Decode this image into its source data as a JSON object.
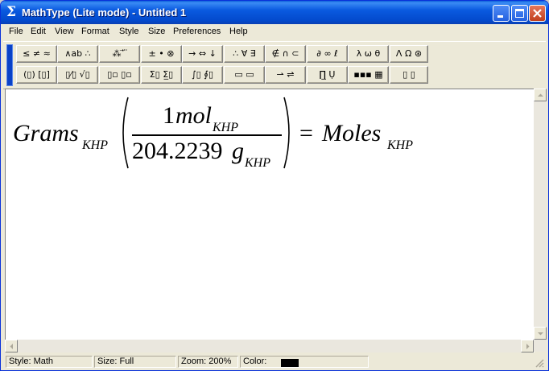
{
  "window": {
    "title": "MathType (Lite mode) - Untitled 1",
    "app_icon_glyph": "Σ",
    "controls": [
      "minimize-icon",
      "maximize-icon",
      "close-icon"
    ]
  },
  "menu": {
    "items": [
      "File",
      "Edit",
      "View",
      "Format",
      "Style",
      "Size",
      "Preferences",
      "Help"
    ]
  },
  "toolbar": {
    "row1": [
      {
        "icon": "relations-palette-icon",
        "glyph": "≤ ≠ ≈"
      },
      {
        "icon": "spaces-ellipses-palette-icon",
        "glyph": "∧ab ∴"
      },
      {
        "icon": "embellishments-palette-icon",
        "glyph": "⁂ ⃗ ⃛"
      },
      {
        "icon": "operators-palette-icon",
        "glyph": "± • ⊗"
      },
      {
        "icon": "arrows-palette-icon",
        "glyph": "→ ⇔ ↓"
      },
      {
        "icon": "logic-palette-icon",
        "glyph": "∴ ∀ ∃"
      },
      {
        "icon": "set-theory-palette-icon",
        "glyph": "∉ ∩ ⊂"
      },
      {
        "icon": "calculus-palette-icon",
        "glyph": "∂ ∞ ℓ"
      },
      {
        "icon": "greek-lower-palette-icon",
        "glyph": "λ ω θ"
      },
      {
        "icon": "greek-upper-palette-icon",
        "glyph": "Λ Ω ⊛"
      }
    ],
    "row2": [
      {
        "icon": "fences-palette-icon",
        "glyph": "(▯) [▯]"
      },
      {
        "icon": "fractions-radicals-palette-icon",
        "glyph": "▯⁄▯ √▯"
      },
      {
        "icon": "subscripts-palette-icon",
        "glyph": "▯▫ ▯▫"
      },
      {
        "icon": "summations-palette-icon",
        "glyph": "Σ▯ Σ̲▯"
      },
      {
        "icon": "integrals-palette-icon",
        "glyph": "∫▯ ∮▯"
      },
      {
        "icon": "underbars-palette-icon",
        "glyph": "▭ ▭"
      },
      {
        "icon": "labeled-arrows-palette-icon",
        "glyph": "⇀ ⇌"
      },
      {
        "icon": "products-palette-icon",
        "glyph": "∏̲ Ụ"
      },
      {
        "icon": "matrices-palette-icon",
        "glyph": "▪▪▪ ▦"
      },
      {
        "icon": "boxes-palette-icon",
        "glyph": "▯ ▯"
      }
    ]
  },
  "equation": {
    "lhs_var": "Grams",
    "lhs_sub": "KHP",
    "num_coef": "1",
    "num_var": "mol",
    "num_sub": "KHP",
    "den_coef": "204.2239",
    "den_var": "g",
    "den_sub": "KHP",
    "equals": "=",
    "rhs_var": "Moles",
    "rhs_sub": "KHP"
  },
  "status": {
    "style": "Style: Math",
    "size": "Size: Full",
    "zoom": "Zoom: 200%",
    "color_label": "Color:",
    "color_value": "#000000"
  }
}
